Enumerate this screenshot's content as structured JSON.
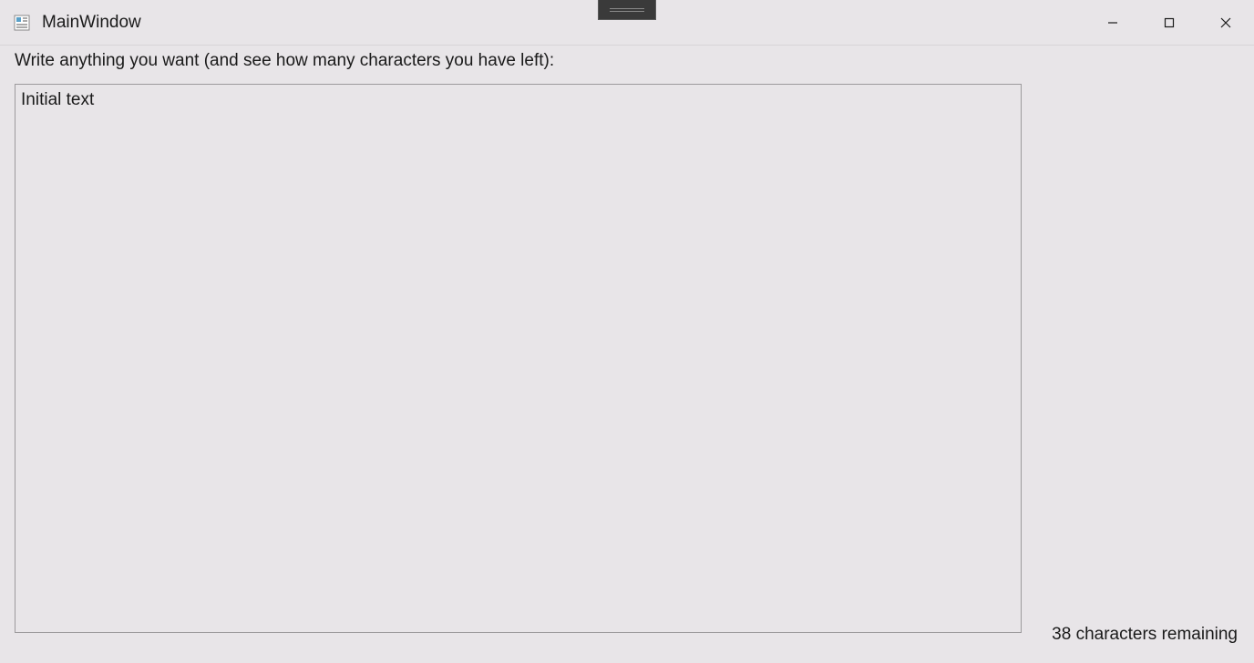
{
  "window": {
    "title": "MainWindow"
  },
  "content": {
    "prompt": "Write anything you want (and see how many characters you have left):",
    "textbox_value": "Initial text",
    "status": "38 characters remaining"
  }
}
